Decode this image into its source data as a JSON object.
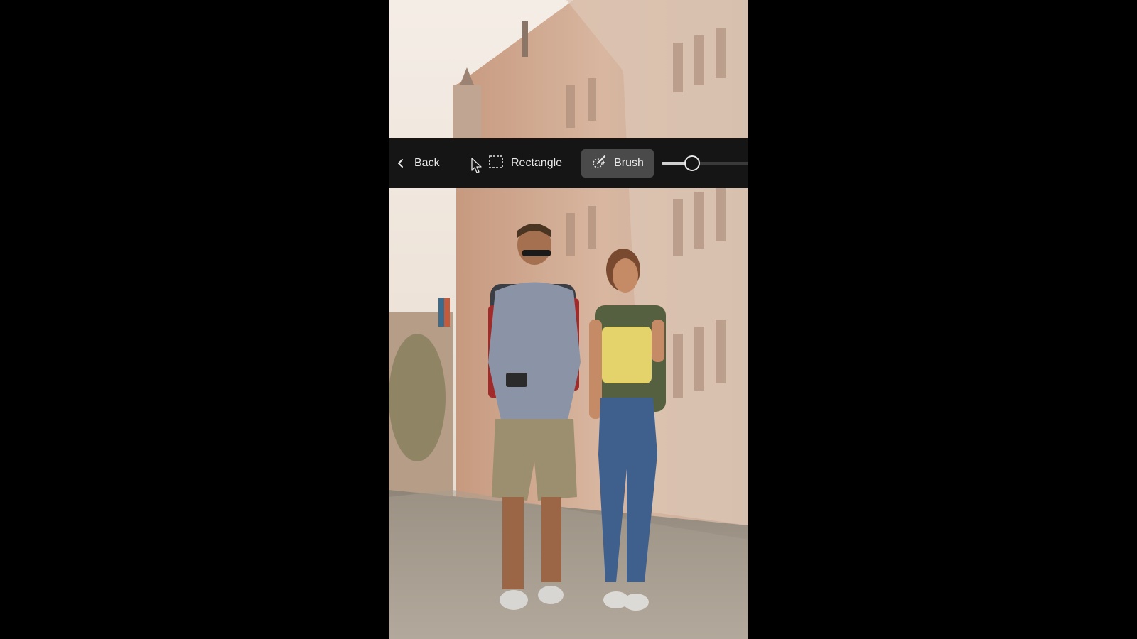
{
  "toolbar": {
    "back_label": "Back",
    "rectangle_label": "Rectangle",
    "brush_label": "Brush",
    "brush_size_fraction": 0.33,
    "icons": {
      "back": "chevron-left-icon",
      "rectangle": "marquee-rectangle-icon",
      "brush": "brush-sparkle-icon",
      "cursor": "mouse-pointer-icon"
    }
  },
  "photo": {
    "subject": "travel-couple-walking-street"
  }
}
